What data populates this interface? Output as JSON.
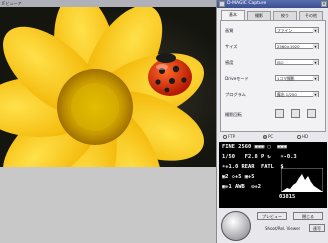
{
  "viewer": {
    "title": "IFビューア"
  },
  "capture": {
    "title": "D-MAGIC Capture",
    "tabs": [
      "基本",
      "撮影",
      "絞り",
      "その他"
    ],
    "rows": [
      {
        "label": "画質",
        "value": "ファイン"
      },
      {
        "label": "サイズ",
        "value": "2560×1920"
      },
      {
        "label": "感度",
        "value": "ISO"
      },
      {
        "label": "Driveモード",
        "value": "1コマ撮影"
      },
      {
        "label": "プログラム",
        "value": "露出 1/250"
      }
    ],
    "rotate_label": "撮影回転",
    "radio_options": [
      "FTP",
      "PC",
      "HD"
    ],
    "lcd": {
      "line1": "FINE 2560 ▣▣▣ ▢  ▣▣▣",
      "line2": "1/50   F2.8 P ↻   ☀-0.3",
      "line3": "☀+1.0 REAR  FATL  $",
      "line4": "▣2 ◇+5 ▣+5",
      "line5": "▣+1 AWB  ◎+2",
      "count": "03815"
    },
    "preview_label": "プレビュー",
    "exit_label": "閉じる",
    "shutter_label": "Shoot/Rel. Viewer",
    "options_label": "連写"
  }
}
